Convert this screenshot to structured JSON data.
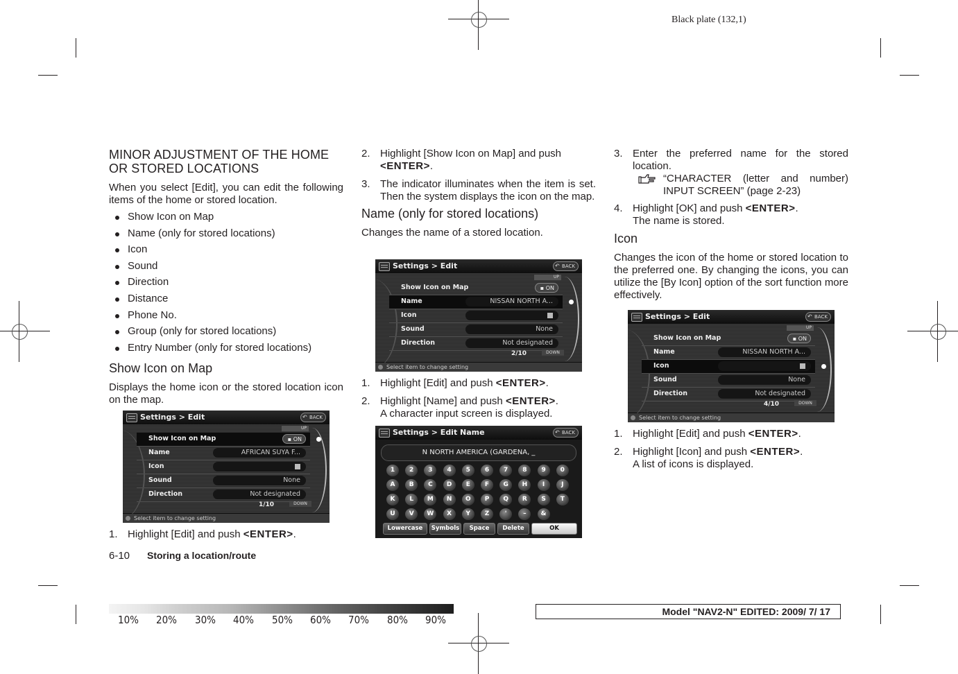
{
  "plate": "Black plate (132,1)",
  "col1": {
    "heading": "MINOR ADJUSTMENT OF THE HOME OR STORED LOCATIONS",
    "intro": "When you select [Edit], you can edit the following items of the home or stored location.",
    "bullets": [
      "Show Icon on Map",
      "Name (only for stored locations)",
      "Icon",
      "Sound",
      "Direction",
      "Distance",
      "Phone No.",
      "Group (only for stored locations)",
      "Entry Number (only for stored locations)"
    ],
    "subheading": "Show Icon on Map",
    "desc": "Displays the home icon or the stored location icon on the map.",
    "steps": [
      {
        "num": "1.",
        "pre": "Highlight [Edit] and push ",
        "key": "<ENTER>",
        "post": "."
      }
    ]
  },
  "col2": {
    "steps_a": [
      {
        "num": "2.",
        "pre": "Highlight [Show Icon on Map] and push ",
        "key": "<ENTER>",
        "post": "."
      },
      {
        "num": "3.",
        "text": "The indicator illuminates when the item is set. Then the system displays the icon on the map."
      }
    ],
    "subheading": "Name (only for stored locations)",
    "desc": "Changes the name of a stored location.",
    "steps_b": [
      {
        "num": "1.",
        "pre": "Highlight [Edit] and push ",
        "key": "<ENTER>",
        "post": "."
      },
      {
        "num": "2.",
        "pre": "Highlight [Name] and push ",
        "key": "<ENTER>",
        "post": ".",
        "extra": "A character input screen is displayed."
      }
    ]
  },
  "col3": {
    "steps_a": [
      {
        "num": "3.",
        "text": "Enter the preferred name for the stored location.",
        "ref": "“CHARACTER (letter and number) INPUT SCREEN” (page 2-23)"
      },
      {
        "num": "4.",
        "pre": "Highlight [OK] and push ",
        "key": "<ENTER>",
        "post": ".",
        "extra": "The name is stored."
      }
    ],
    "subheading": "Icon",
    "desc": "Changes the icon of the home or stored location to the preferred one. By changing the icons, you can utilize the [By Icon] option of the sort function more effectively.",
    "steps_b": [
      {
        "num": "1.",
        "pre": "Highlight [Edit] and push ",
        "key": "<ENTER>",
        "post": "."
      },
      {
        "num": "2.",
        "pre": "Highlight [Icon] and push ",
        "key": "<ENTER>",
        "post": ".",
        "extra": "A list of icons is displayed."
      }
    ]
  },
  "screens": {
    "edit1": {
      "title": "Settings > Edit",
      "back": "BACK",
      "up": "UP",
      "down": "DOWN",
      "page": "1/10",
      "footer": "Select item to change setting",
      "selected": 0,
      "rows": [
        {
          "label": "Show Icon on Map",
          "value": "▪ ON",
          "type": "on"
        },
        {
          "label": "Name",
          "value": "AFRICAN SUYA F...",
          "type": "text"
        },
        {
          "label": "Icon",
          "value": "",
          "type": "icon"
        },
        {
          "label": "Sound",
          "value": "None",
          "type": "text"
        },
        {
          "label": "Direction",
          "value": "Not designated",
          "type": "text"
        }
      ]
    },
    "edit2": {
      "title": "Settings > Edit",
      "back": "BACK",
      "up": "UP",
      "down": "DOWN",
      "page": "2/10",
      "footer": "Select item to change setting",
      "selected": 1,
      "rows": [
        {
          "label": "Show Icon on Map",
          "value": "▪ ON",
          "type": "on"
        },
        {
          "label": "Name",
          "value": "NISSAN NORTH A...",
          "type": "text"
        },
        {
          "label": "Icon",
          "value": "",
          "type": "icon"
        },
        {
          "label": "Sound",
          "value": "None",
          "type": "text"
        },
        {
          "label": "Direction",
          "value": "Not designated",
          "type": "text"
        }
      ]
    },
    "edit4": {
      "title": "Settings > Edit",
      "back": "BACK",
      "up": "UP",
      "down": "DOWN",
      "page": "4/10",
      "footer": "Select item to change setting",
      "selected": 2,
      "rows": [
        {
          "label": "Show Icon on Map",
          "value": "▪ ON",
          "type": "on"
        },
        {
          "label": "Name",
          "value": "NISSAN NORTH A...",
          "type": "text"
        },
        {
          "label": "Icon",
          "value": "",
          "type": "icon"
        },
        {
          "label": "Sound",
          "value": "None",
          "type": "text"
        },
        {
          "label": "Direction",
          "value": "Not designated",
          "type": "text"
        }
      ]
    },
    "editname": {
      "title": "Settings > Edit Name",
      "back": "BACK",
      "input": "N NORTH AMERICA (GARDENA, _",
      "keys": [
        [
          "1",
          "2",
          "3",
          "4",
          "5",
          "6",
          "7",
          "8",
          "9",
          "0"
        ],
        [
          "A",
          "B",
          "C",
          "D",
          "E",
          "F",
          "G",
          "H",
          "I",
          "J"
        ],
        [
          "K",
          "L",
          "M",
          "N",
          "O",
          "P",
          "Q",
          "R",
          "S",
          "T"
        ],
        [
          "U",
          "V",
          "W",
          "X",
          "Y",
          "Z",
          "'",
          "–",
          "&"
        ]
      ],
      "buttons": [
        "Lowercase",
        "Symbols",
        "Space",
        "Delete",
        "OK"
      ]
    }
  },
  "footer": {
    "page_number": "6-10",
    "section": "Storing a location/route",
    "gradient_labels": [
      "10%",
      "20%",
      "30%",
      "40%",
      "50%",
      "60%",
      "70%",
      "80%",
      "90%"
    ],
    "model": "Model \"NAV2-N\"  EDITED:  2009/ 7/ 17"
  }
}
